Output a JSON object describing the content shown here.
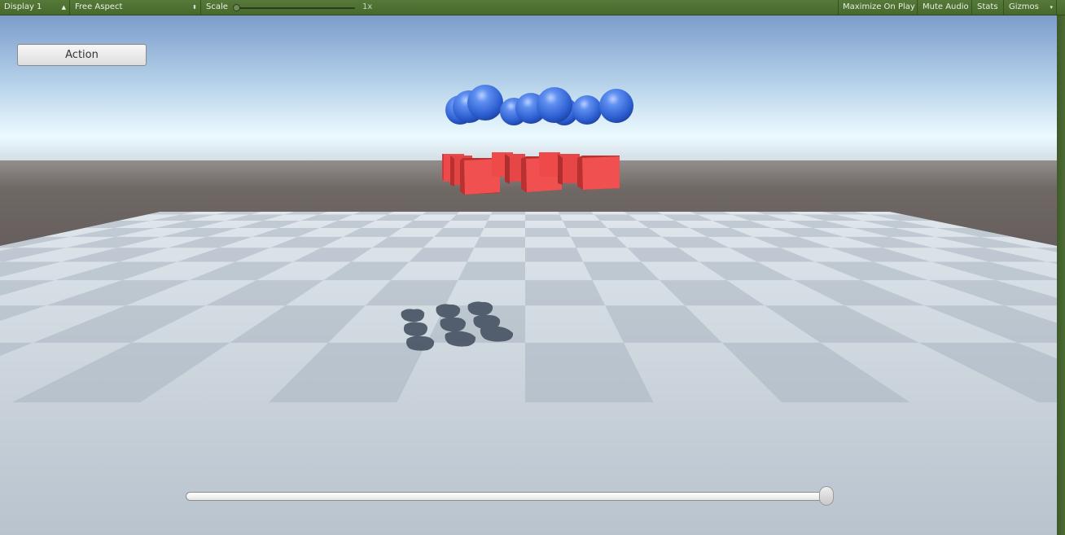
{
  "toolbar": {
    "display": "Display 1",
    "aspect": "Free Aspect",
    "scale_label": "Scale",
    "scale_value": "1x",
    "maximize": "Maximize On Play",
    "mute": "Mute Audio",
    "stats": "Stats",
    "gizmos": "Gizmos"
  },
  "ui": {
    "action_label": "Action",
    "slider_value": 1.0
  },
  "colors": {
    "sky_top": "#7f9fcd",
    "sky_horizon": "#eefaff",
    "ground_far": "#6b6462",
    "floor": "#c6d0da",
    "sphere": "#3a6fe0",
    "cube": "#ee4a4a",
    "shadow": "#4c5866"
  },
  "icons": {
    "dropdown": "up-down-arrow-icon",
    "gizmos_dropdown": "down-arrow-icon"
  }
}
